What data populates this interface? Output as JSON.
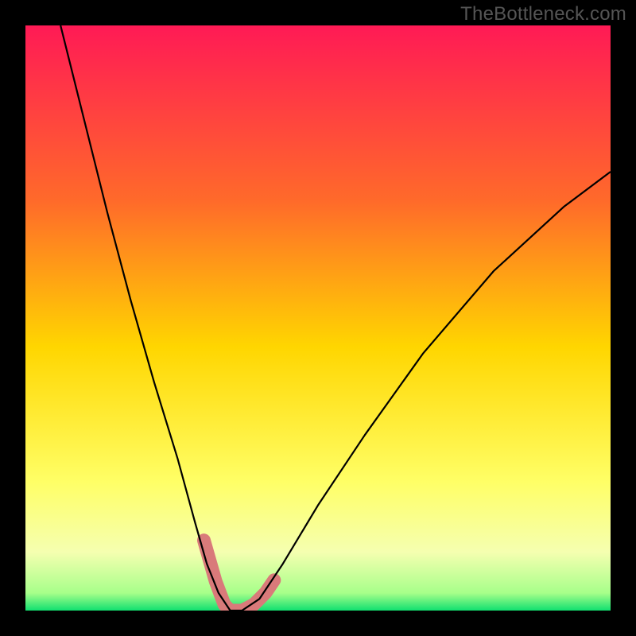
{
  "watermark": "TheBottleneck.com",
  "chart_data": {
    "type": "line",
    "title": "",
    "xlabel": "",
    "ylabel": "",
    "xlim": [
      0,
      100
    ],
    "ylim": [
      0,
      100
    ],
    "gradient_stops": [
      {
        "offset": 0,
        "color": "#ff1a55"
      },
      {
        "offset": 0.3,
        "color": "#ff6a2a"
      },
      {
        "offset": 0.55,
        "color": "#ffd600"
      },
      {
        "offset": 0.78,
        "color": "#ffff66"
      },
      {
        "offset": 0.9,
        "color": "#f5ffb0"
      },
      {
        "offset": 0.97,
        "color": "#a7ff8a"
      },
      {
        "offset": 1.0,
        "color": "#10e070"
      }
    ],
    "series": [
      {
        "name": "bottleneck-curve",
        "type": "line",
        "color": "#000000",
        "stroke_width": 2.2,
        "points": [
          {
            "x": 6,
            "y": 100
          },
          {
            "x": 10,
            "y": 84
          },
          {
            "x": 14,
            "y": 68
          },
          {
            "x": 18,
            "y": 53
          },
          {
            "x": 22,
            "y": 39
          },
          {
            "x": 26,
            "y": 26
          },
          {
            "x": 29,
            "y": 15
          },
          {
            "x": 31,
            "y": 8
          },
          {
            "x": 33,
            "y": 3
          },
          {
            "x": 35,
            "y": 0
          },
          {
            "x": 37,
            "y": 0
          },
          {
            "x": 40,
            "y": 2
          },
          {
            "x": 44,
            "y": 8
          },
          {
            "x": 50,
            "y": 18
          },
          {
            "x": 58,
            "y": 30
          },
          {
            "x": 68,
            "y": 44
          },
          {
            "x": 80,
            "y": 58
          },
          {
            "x": 92,
            "y": 69
          },
          {
            "x": 100,
            "y": 75
          }
        ]
      },
      {
        "name": "highlight-left",
        "type": "marker-band",
        "color": "#d97a7a",
        "stroke_width": 17,
        "linecap": "round",
        "points": [
          {
            "x": 30.5,
            "y": 12
          },
          {
            "x": 32.5,
            "y": 5
          },
          {
            "x": 34,
            "y": 1
          },
          {
            "x": 35,
            "y": 0
          }
        ]
      },
      {
        "name": "highlight-right",
        "type": "marker-band",
        "color": "#d97a7a",
        "stroke_width": 17,
        "linecap": "round",
        "points": [
          {
            "x": 35,
            "y": 0
          },
          {
            "x": 37,
            "y": 0
          },
          {
            "x": 39,
            "y": 1
          },
          {
            "x": 41,
            "y": 3
          },
          {
            "x": 42.5,
            "y": 5.2
          }
        ]
      }
    ]
  }
}
